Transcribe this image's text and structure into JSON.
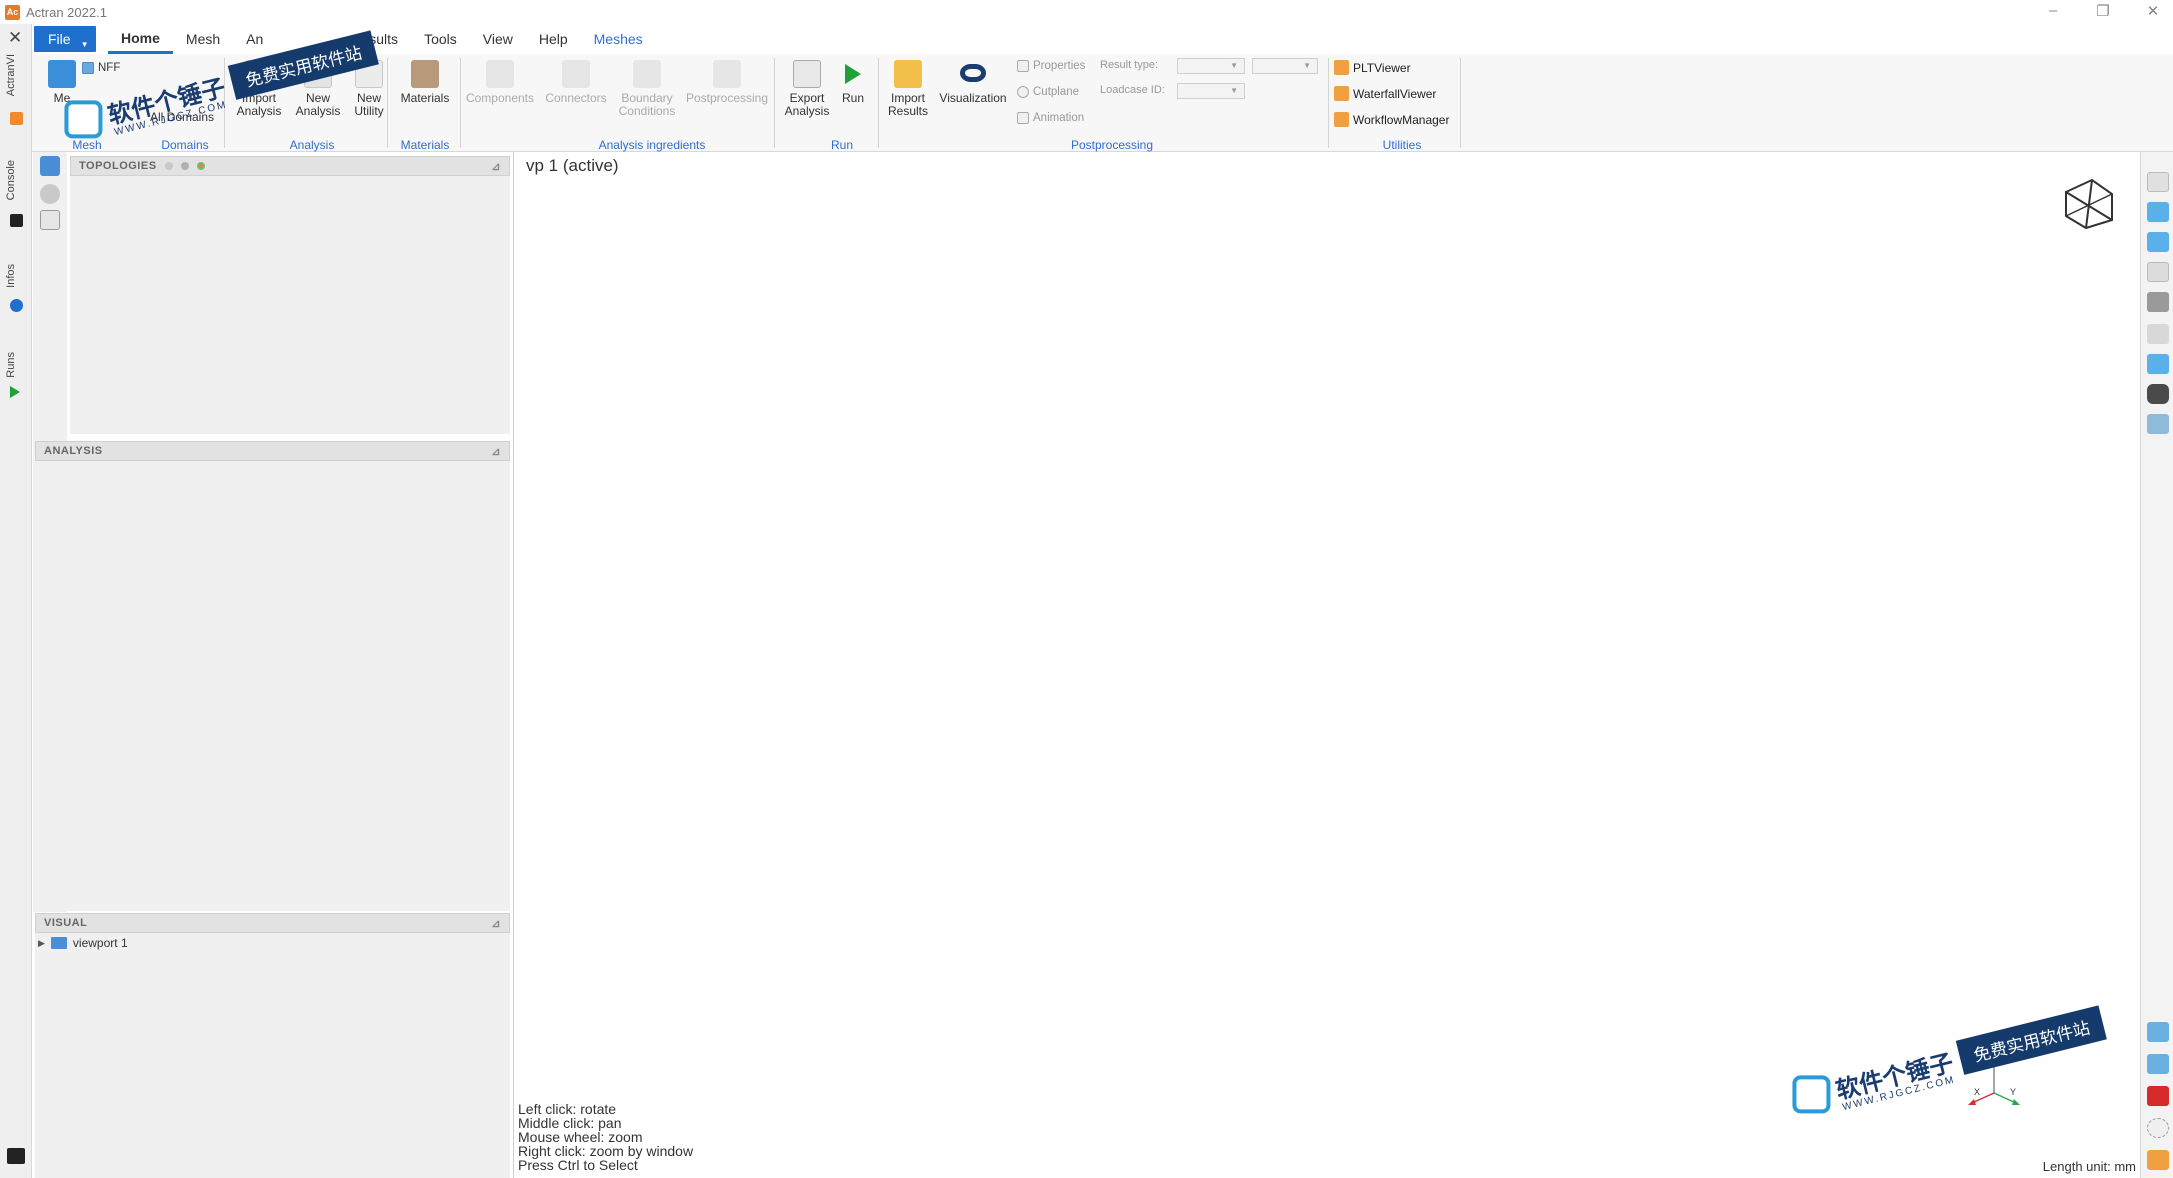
{
  "window": {
    "title": "Actran 2022.1",
    "app_icon_text": "Ac",
    "controls": [
      "–",
      "❐",
      "✕"
    ]
  },
  "left_strip": {
    "close_glyph": "✕",
    "tabs": [
      "ActranVI",
      "Console",
      "Infos",
      "Runs"
    ]
  },
  "menubar": {
    "file_label": "File",
    "items": [
      "Home",
      "Mesh",
      "An",
      "sults",
      "Tools",
      "View",
      "Help",
      "Meshes"
    ]
  },
  "ribbon": {
    "mesh_partial": "Me",
    "nff_label": "NFF",
    "domains_label": "All Domains",
    "import_analysis": [
      "Import",
      "Analysis"
    ],
    "new_analysis": [
      "New",
      "Analysis"
    ],
    "new_utility": [
      "New",
      "Utility"
    ],
    "materials": "Materials",
    "components": "Components",
    "connectors": "Connectors",
    "boundary_conditions": [
      "Boundary",
      "Conditions"
    ],
    "postprocessing": "Postprocessing",
    "export_analysis": [
      "Export",
      "Analysis"
    ],
    "run": "Run",
    "import_results": [
      "Import",
      "Results"
    ],
    "visualization": "Visualization",
    "properties": "Properties",
    "cutplane": "Cutplane",
    "animation": "Animation",
    "result_type_label": "Result type:",
    "loadcase_id_label": "Loadcase ID:",
    "utilities": [
      "PLTViewer",
      "WaterfallViewer",
      "WorkflowManager"
    ],
    "groups": [
      "Mesh",
      "Domains",
      "Analysis",
      "Materials",
      "Analysis ingredients",
      "Run",
      "Postprocessing",
      "Utilities"
    ]
  },
  "watermark": {
    "name": "软件个锤子",
    "url": "WWW.RJGCZ.COM",
    "banner": "免费实用软件站"
  },
  "panels": {
    "topologies": "TOPOLOGIES",
    "analysis": "ANALYSIS",
    "visual": "VISUAL",
    "visual_items": [
      "viewport 1"
    ],
    "pin_glyph": "⊿"
  },
  "viewport": {
    "title": "vp 1 (active)",
    "hints": [
      "Left click: rotate",
      "Middle click: pan",
      "Mouse wheel: zoom",
      "Right click: zoom by window",
      "Press Ctrl to Select"
    ],
    "length_unit": "Length unit: mm",
    "axes": {
      "x": "X",
      "y": "Y"
    }
  },
  "colors": {
    "accent": "#1f6fcc",
    "group_label": "#2f6fd4",
    "watermark_navy": "#153a6c",
    "run_green": "#1fa038",
    "utility_orange": "#f0a040"
  }
}
